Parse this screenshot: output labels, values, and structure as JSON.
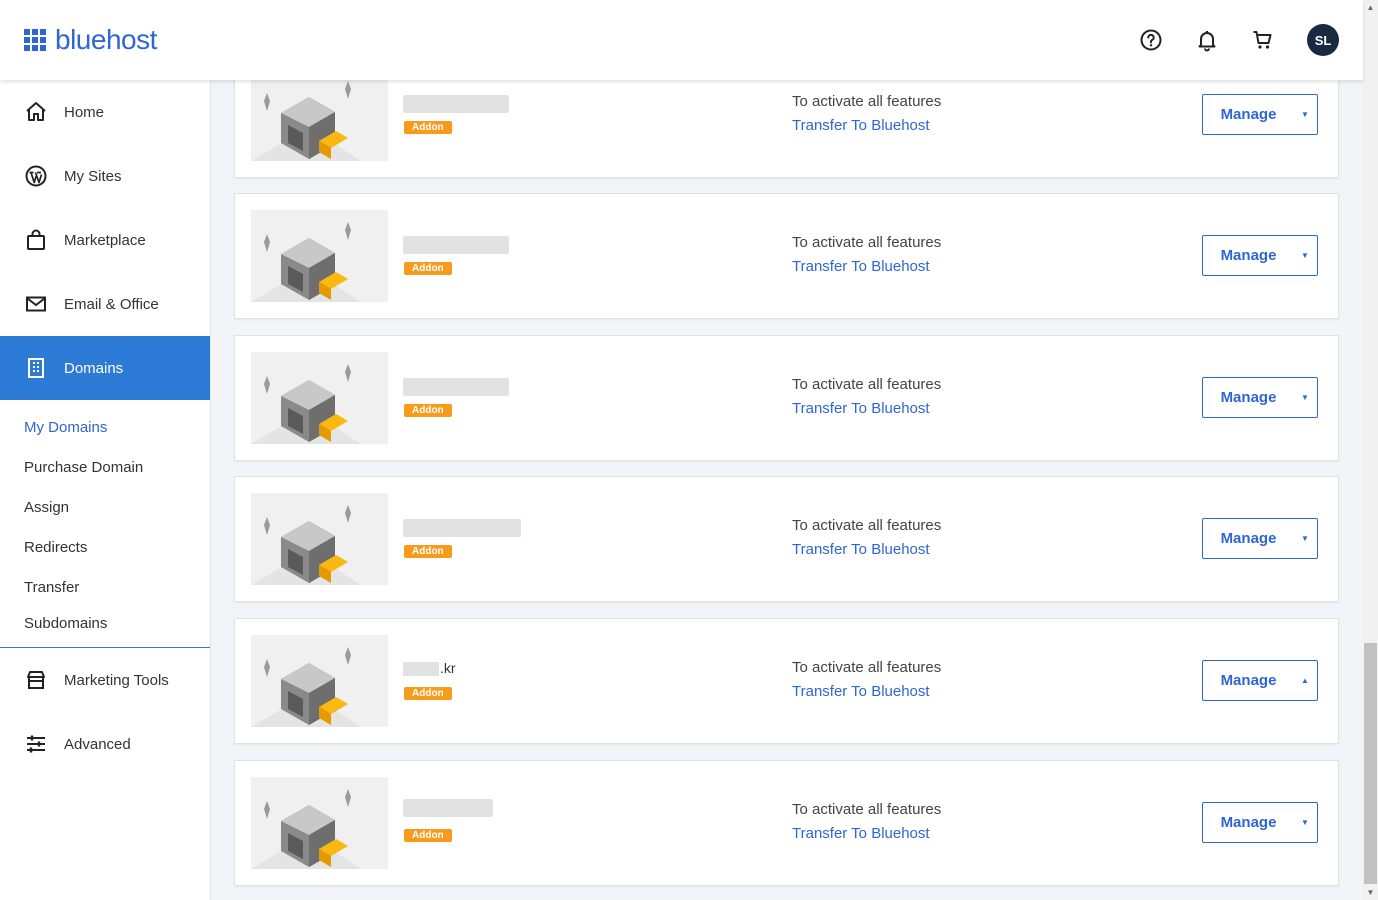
{
  "header": {
    "brand": "bluehost",
    "avatar_initials": "SL",
    "icons": [
      "help-icon",
      "bell-icon",
      "cart-icon"
    ]
  },
  "sidebar": {
    "items": [
      {
        "label": "Home",
        "icon": "home-icon"
      },
      {
        "label": "My Sites",
        "icon": "wordpress-icon"
      },
      {
        "label": "Marketplace",
        "icon": "shopping-bag-icon"
      },
      {
        "label": "Email & Office",
        "icon": "envelope-icon"
      },
      {
        "label": "Domains",
        "icon": "building-icon",
        "active": true
      },
      {
        "label": "Marketing Tools",
        "icon": "storefront-icon"
      },
      {
        "label": "Advanced",
        "icon": "sliders-icon"
      }
    ],
    "domains_submenu": [
      {
        "label": "My Domains",
        "active": true
      },
      {
        "label": "Purchase Domain"
      },
      {
        "label": "Assign"
      },
      {
        "label": "Redirects"
      },
      {
        "label": "Transfer"
      },
      {
        "label": "Subdomains"
      }
    ]
  },
  "domains": {
    "cards": [
      {
        "domain_suffix": "",
        "badge": "Addon",
        "note": "To activate all features",
        "link": "Transfer To Bluehost",
        "manage_label": "Manage",
        "caret": "▼"
      },
      {
        "domain_suffix": "",
        "badge": "Addon",
        "note": "To activate all features",
        "link": "Transfer To Bluehost",
        "manage_label": "Manage",
        "caret": "▼"
      },
      {
        "domain_suffix": "",
        "badge": "Addon",
        "note": "To activate all features",
        "link": "Transfer To Bluehost",
        "manage_label": "Manage",
        "caret": "▼"
      },
      {
        "domain_suffix": "",
        "badge": "Addon",
        "note": "To activate all features",
        "link": "Transfer To Bluehost",
        "manage_label": "Manage",
        "caret": "▼"
      },
      {
        "domain_suffix": ".kr",
        "badge": "Addon",
        "note": "To activate all features",
        "link": "Transfer To Bluehost",
        "manage_label": "Manage",
        "caret": "▲"
      },
      {
        "domain_suffix": "",
        "badge": "Addon",
        "note": "To activate all features",
        "link": "Transfer To Bluehost",
        "manage_label": "Manage",
        "caret": "▼"
      }
    ]
  },
  "colors": {
    "brand_blue": "#2e66d4",
    "active_nav": "#2e7ad7",
    "badge_orange": "#f89b1c",
    "avatar_bg": "#172a3f"
  }
}
